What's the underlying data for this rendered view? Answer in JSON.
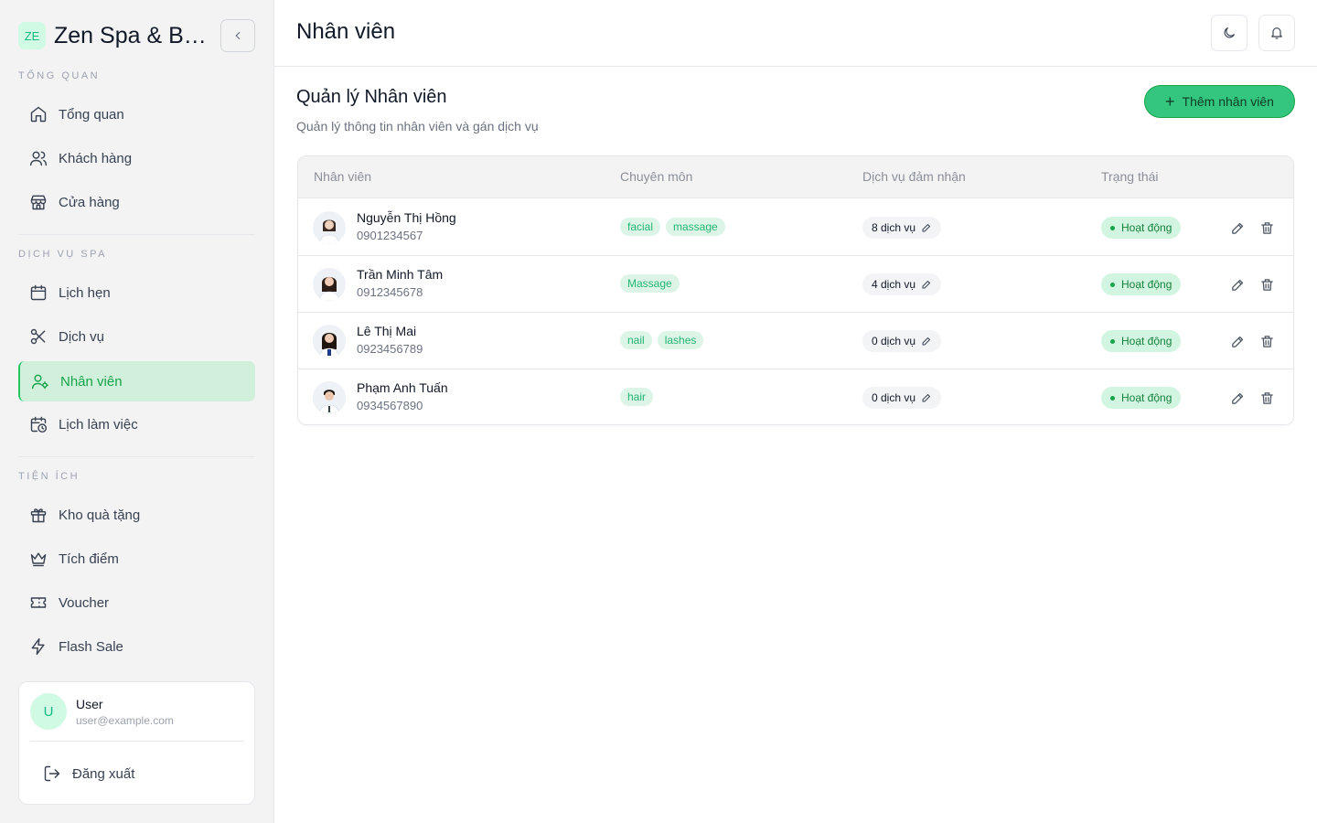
{
  "brand": {
    "logo_text": "ZE",
    "name": "Zen Spa & Beauty"
  },
  "sidebar": {
    "sections": [
      {
        "label": "TỔNG QUAN",
        "items": [
          {
            "label": "Tổng quan",
            "icon": "home-icon"
          },
          {
            "label": "Khách hàng",
            "icon": "users-icon"
          },
          {
            "label": "Cửa hàng",
            "icon": "store-icon"
          }
        ]
      },
      {
        "label": "DỊCH VỤ SPA",
        "items": [
          {
            "label": "Lịch hẹn",
            "icon": "calendar-icon"
          },
          {
            "label": "Dịch vụ",
            "icon": "scissors-icon"
          },
          {
            "label": "Nhân viên",
            "icon": "user-cog-icon",
            "active": true
          },
          {
            "label": "Lịch làm việc",
            "icon": "calendar-clock-icon"
          }
        ]
      },
      {
        "label": "TIỆN ÍCH",
        "items": [
          {
            "label": "Kho quà tặng",
            "icon": "gift-icon"
          },
          {
            "label": "Tích điểm",
            "icon": "crown-icon"
          },
          {
            "label": "Voucher",
            "icon": "ticket-icon"
          },
          {
            "label": "Flash Sale",
            "icon": "zap-icon"
          }
        ]
      }
    ]
  },
  "user": {
    "initial": "U",
    "name": "User",
    "email": "user@example.com",
    "logout_label": "Đăng xuất"
  },
  "header": {
    "title": "Nhân viên"
  },
  "main": {
    "title": "Quản lý Nhân viên",
    "subtitle": "Quản lý thông tin nhân viên và gán dịch vụ",
    "add_button": "Thêm nhân viên"
  },
  "table": {
    "columns": [
      "Nhân viên",
      "Chuyên môn",
      "Dịch vụ đảm nhận",
      "Trạng thái"
    ],
    "rows": [
      {
        "name": "Nguyễn Thị Hồng",
        "phone": "0901234567",
        "tags": [
          "facial",
          "massage"
        ],
        "services": "8 dịch vụ",
        "status": "Hoạt động"
      },
      {
        "name": "Trần Minh Tâm",
        "phone": "0912345678",
        "tags": [
          "Massage"
        ],
        "services": "4 dịch vụ",
        "status": "Hoạt động"
      },
      {
        "name": "Lê Thị Mai",
        "phone": "0923456789",
        "tags": [
          "nail",
          "lashes"
        ],
        "services": "0 dịch vụ",
        "status": "Hoạt động"
      },
      {
        "name": "Phạm Anh Tuấn",
        "phone": "0934567890",
        "tags": [
          "hair"
        ],
        "services": "0 dịch vụ",
        "status": "Hoạt động"
      }
    ]
  },
  "colors": {
    "accent": "#34c67f",
    "active_bg": "#d1f0dc",
    "tag_text": "#22b573"
  }
}
